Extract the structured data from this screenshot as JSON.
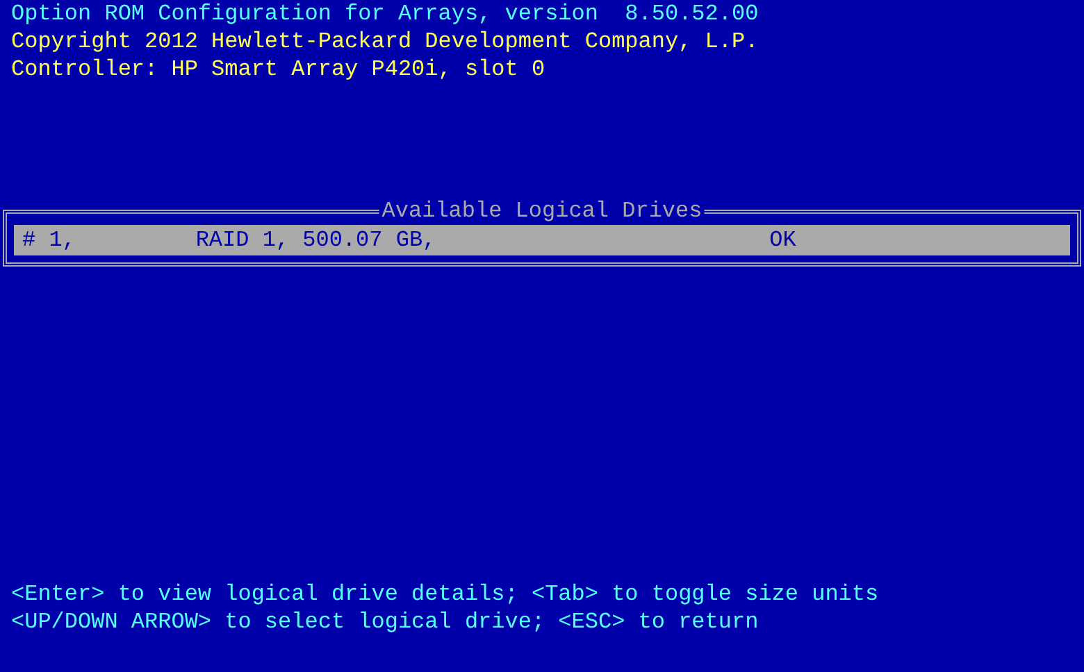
{
  "header": [
    {
      "text": "Option ROM Configuration for Arrays, version  8.50.52.00",
      "kind": "title"
    },
    {
      "text": "Copyright 2012 Hewlett-Packard Development Company, L.P.",
      "kind": "info"
    },
    {
      "text": "Controller: HP Smart Array P420i, slot 0",
      "kind": "info"
    }
  ],
  "panel": {
    "title": "Available Logical Drives",
    "drives": [
      {
        "number": "# 1,",
        "raid": "RAID 1,",
        "size": "500.07 GB,",
        "status": "OK",
        "selected": true
      }
    ]
  },
  "help_lines": [
    "<Enter> to view logical drive details; <Tab> to toggle size units",
    "<UP/DOWN ARROW> to select logical drive; <ESC> to return"
  ]
}
